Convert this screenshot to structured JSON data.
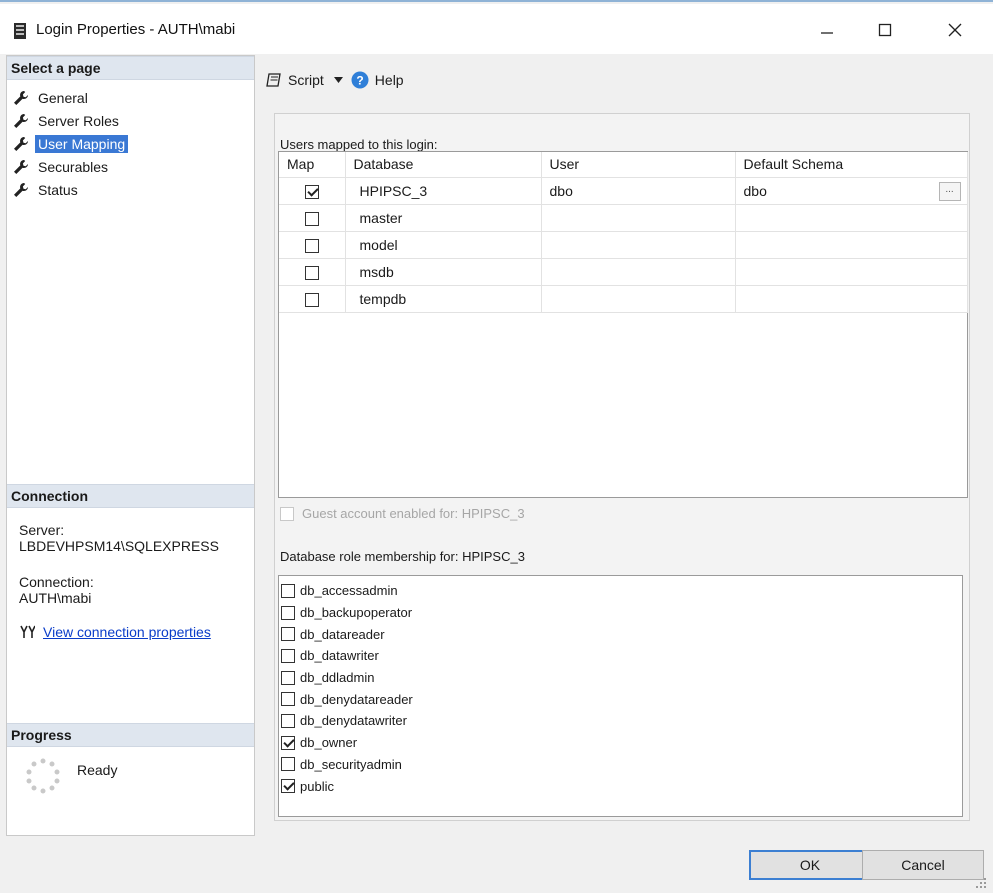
{
  "window": {
    "title": "Login Properties - AUTH\\mabi"
  },
  "left": {
    "select_page_header": "Select a page",
    "pages": [
      {
        "label": "General",
        "selected": false
      },
      {
        "label": "Server Roles",
        "selected": false
      },
      {
        "label": "User Mapping",
        "selected": true
      },
      {
        "label": "Securables",
        "selected": false
      },
      {
        "label": "Status",
        "selected": false
      }
    ],
    "connection_header": "Connection",
    "server_label": "Server:",
    "server_value": "LBDEVHPSM14\\SQLEXPRESS",
    "connection_label": "Connection:",
    "connection_value": "AUTH\\mabi",
    "view_connection_link": "View connection properties",
    "progress_header": "Progress",
    "progress_status": "Ready"
  },
  "toolbar": {
    "script_label": "Script",
    "help_label": "Help"
  },
  "users_grid": {
    "label": "Users mapped to this login:",
    "columns": [
      "Map",
      "Database",
      "User",
      "Default Schema"
    ],
    "rows": [
      {
        "map": true,
        "database": "HPIPSC_3",
        "user": "dbo",
        "schema": "dbo",
        "browse": "..."
      },
      {
        "map": false,
        "database": "master",
        "user": "",
        "schema": ""
      },
      {
        "map": false,
        "database": "model",
        "user": "",
        "schema": ""
      },
      {
        "map": false,
        "database": "msdb",
        "user": "",
        "schema": ""
      },
      {
        "map": false,
        "database": "tempdb",
        "user": "",
        "schema": ""
      }
    ]
  },
  "guest": {
    "label": "Guest account enabled for: HPIPSC_3",
    "checked": false
  },
  "roles": {
    "label": "Database role membership for: HPIPSC_3",
    "items": [
      {
        "label": "db_accessadmin",
        "checked": false
      },
      {
        "label": "db_backupoperator",
        "checked": false
      },
      {
        "label": "db_datareader",
        "checked": false
      },
      {
        "label": "db_datawriter",
        "checked": false
      },
      {
        "label": "db_ddladmin",
        "checked": false
      },
      {
        "label": "db_denydatareader",
        "checked": false
      },
      {
        "label": "db_denydatawriter",
        "checked": false
      },
      {
        "label": "db_owner",
        "checked": true
      },
      {
        "label": "db_securityadmin",
        "checked": false
      },
      {
        "label": "public",
        "checked": true
      }
    ]
  },
  "buttons": {
    "ok": "OK",
    "cancel": "Cancel"
  },
  "colors": {
    "selected_bg": "#3a78d4",
    "section_bg": "#dfe6ef",
    "link": "#0a3cc9",
    "ok_border": "#3c7fd2"
  }
}
